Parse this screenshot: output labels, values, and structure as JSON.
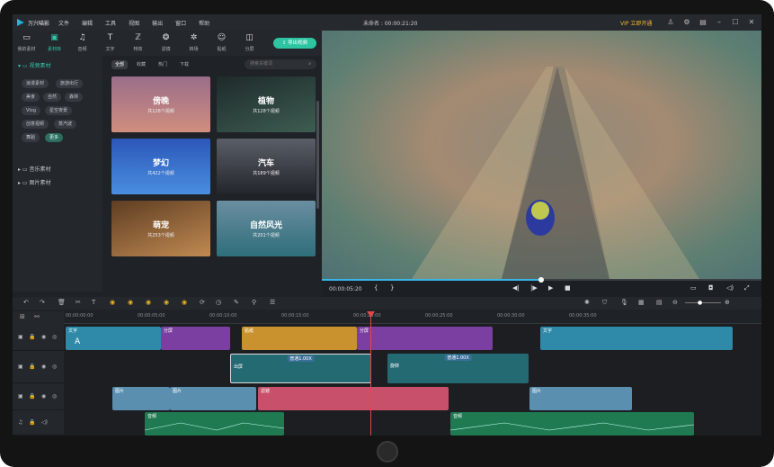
{
  "app": {
    "name": "万兴喵影",
    "project": "未命名 : 00:00:21:20",
    "vip": "VIP 立即开通"
  },
  "menu": [
    "文件",
    "编辑",
    "工具",
    "视图",
    "输出",
    "窗口",
    "帮助"
  ],
  "tools": [
    {
      "label": "我的素材",
      "icon": "folder-icon"
    },
    {
      "label": "素材库",
      "icon": "library-icon"
    },
    {
      "label": "音频",
      "icon": "music-icon"
    },
    {
      "label": "文字",
      "icon": "text-icon"
    },
    {
      "label": "特效",
      "icon": "effects-icon"
    },
    {
      "label": "滤镜",
      "icon": "filter-icon"
    },
    {
      "label": "转场",
      "icon": "transition-icon"
    },
    {
      "label": "贴纸",
      "icon": "sticker-icon"
    },
    {
      "label": "分屏",
      "icon": "splitscreen-icon"
    }
  ],
  "export_label": "导出视频",
  "library": {
    "tree_video": "视频素材",
    "tags": [
      "浪漫素材",
      "旅游出行",
      "美食",
      "自然",
      "森林",
      "Vlog",
      "星空夜景",
      "创意视频",
      "蒸汽波",
      "舞蹈",
      "更多"
    ],
    "active_tag": "更多",
    "tree_music": "音乐素材",
    "tree_image": "图片素材"
  },
  "media": {
    "tabs": [
      "全部",
      "收藏",
      "热门",
      "下载"
    ],
    "active_tab": "全部",
    "search_placeholder": "搜索关键词",
    "cards": [
      {
        "title": "傍晚",
        "sub": "共128个视频",
        "color": "#b8777e"
      },
      {
        "title": "植物",
        "sub": "共128个视频",
        "color": "#2f4a43"
      },
      {
        "title": "梦幻",
        "sub": "共422个视频",
        "color": "#2f62c0"
      },
      {
        "title": "汽车",
        "sub": "共189个视频",
        "color": "#3a3d44"
      },
      {
        "title": "萌宠",
        "sub": "共253个视频",
        "color": "#8a5b34"
      },
      {
        "title": "自然风光",
        "sub": "共201个视频",
        "color": "#3e7a8a"
      }
    ]
  },
  "player": {
    "timecode": "00:00:05:20",
    "progress": 0.5
  },
  "ruler_marks": [
    "00:00:00:00",
    "00:00:05:00",
    "00:00:10:00",
    "00:00:15:00",
    "00:00:20:00",
    "00:00:25:00",
    "00:00:30:00",
    "00:00:35:00"
  ],
  "timeline": {
    "text_clips": [
      {
        "label": "文字",
        "color": "#2e8aa8"
      },
      {
        "label": "分屏",
        "color": "#7a3fa0"
      },
      {
        "label": "贴纸",
        "color": "#c9922e"
      },
      {
        "label": "分屏",
        "color": "#7a3fa0"
      },
      {
        "label": "文字",
        "color": "#2e8aa8"
      }
    ],
    "video_clips": [
      {
        "label": "出屏",
        "speed": "普通1.00X",
        "color": "#246a73"
      },
      {
        "label": "旋转",
        "speed": "普通1.00X",
        "color": "#246a73"
      }
    ],
    "image_clips": [
      {
        "label": "图片",
        "color": "#5a8fb0"
      },
      {
        "label": "图片",
        "color": "#5a8fb0"
      },
      {
        "label": "滤镜",
        "color": "#c8506a"
      },
      {
        "label": "图片",
        "color": "#5a8fb0"
      }
    ],
    "audio_clips": [
      {
        "label": "音频",
        "color": "#1f7a52"
      },
      {
        "label": "音频",
        "color": "#1f7a52"
      }
    ]
  }
}
